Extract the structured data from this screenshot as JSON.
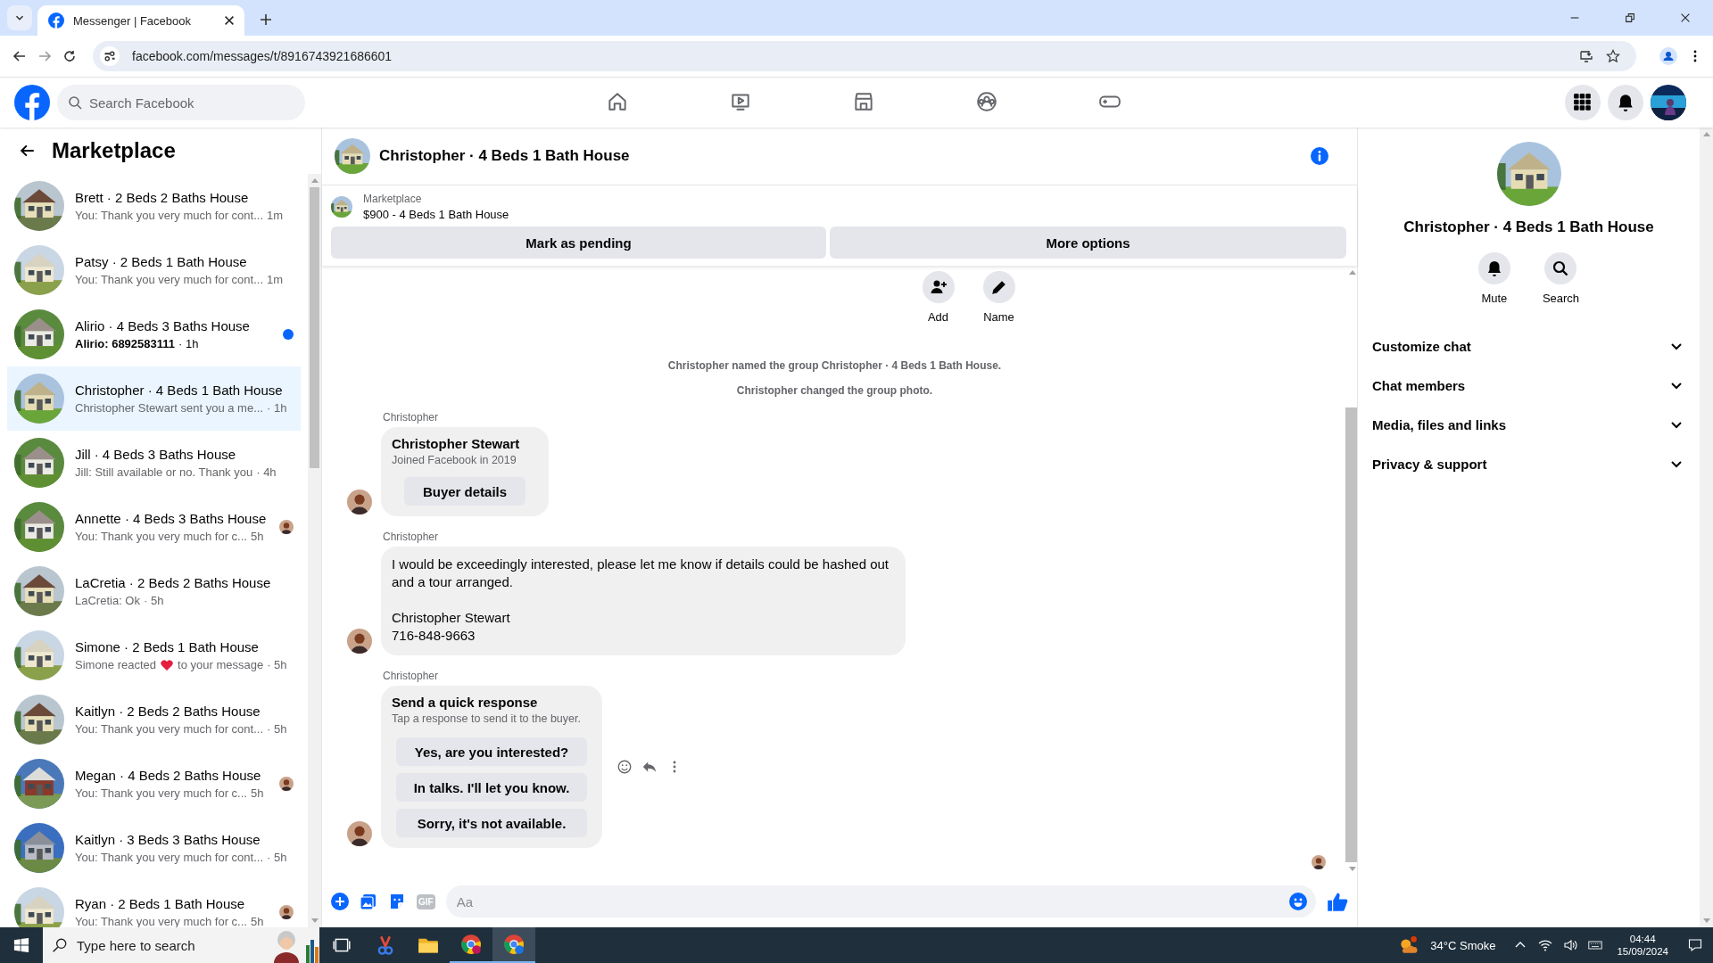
{
  "browser": {
    "tab": {
      "title": "Messenger | Facebook",
      "selected": true
    },
    "url": "facebook.com/messages/t/8916743921686601"
  },
  "topbar": {
    "search_placeholder": "Search Facebook",
    "nav": [
      {
        "selected": false
      },
      {
        "selected": false
      },
      {
        "selected": false
      },
      {
        "selected": false
      },
      {
        "selected": false
      }
    ]
  },
  "sidebar": {
    "title": "Marketplace",
    "conversations": [
      {
        "name": "Brett · 2 Beds 2 Baths House",
        "preview": "You: Thank you very much for cont...",
        "time": "1m",
        "unread": false,
        "seen_avatar": false,
        "selected": false
      },
      {
        "name": "Patsy · 2 Beds 1 Bath House",
        "preview": "You: Thank you very much for cont...",
        "time": "1m",
        "unread": false,
        "seen_avatar": false,
        "selected": false
      },
      {
        "name": "Alirio · 4 Beds 3 Baths House",
        "preview": "Alirio: 6892583111",
        "time": "· 1h",
        "unread": true,
        "seen_avatar": false,
        "selected": false
      },
      {
        "name": "Christopher · 4 Beds 1 Bath House",
        "preview": "Christopher Stewart sent you a me...",
        "time": "· 1h",
        "unread": false,
        "seen_avatar": false,
        "selected": true
      },
      {
        "name": "Jill · 4 Beds 3 Baths House",
        "preview": "Jill: Still available or no. Thank you",
        "time": "· 4h",
        "unread": false,
        "seen_avatar": false,
        "selected": false
      },
      {
        "name": "Annette · 4 Beds 3 Baths House",
        "preview": "You: Thank you very much for c...",
        "time": "5h",
        "unread": false,
        "seen_avatar": true,
        "selected": false
      },
      {
        "name": "LaCretia · 2 Beds 2 Baths House",
        "preview": "LaCretia: Ok",
        "time": "· 5h",
        "unread": false,
        "seen_avatar": false,
        "selected": false
      },
      {
        "name": "Simone · 2 Beds 1 Bath House",
        "preview": "Simone reacted",
        "preview_end": "to your message",
        "time": "· 5h",
        "unread": false,
        "seen_avatar": false,
        "selected": false
      },
      {
        "name": "Kaitlyn · 2 Beds 2 Baths House",
        "preview": "You: Thank you very much for cont...",
        "time": "· 5h",
        "unread": false,
        "seen_avatar": false,
        "selected": false
      },
      {
        "name": "Megan · 4 Beds 2 Baths House",
        "preview": "You: Thank you very much for c...",
        "time": "5h",
        "unread": false,
        "seen_avatar": true,
        "selected": false
      },
      {
        "name": "Kaitlyn · 3 Beds 3 Baths House",
        "preview": "You: Thank you very much for cont...",
        "time": "· 5h",
        "unread": false,
        "seen_avatar": false,
        "selected": false
      },
      {
        "name": "Ryan · 2 Beds 1 Bath House",
        "preview": "You: Thank you very much for c...",
        "time": "5h",
        "unread": false,
        "seen_avatar": true,
        "selected": false
      }
    ]
  },
  "chat": {
    "title": "Christopher · 4 Beds 1 Bath House",
    "listing": {
      "label": "Marketplace",
      "title": "$900 - 4 Beds 1 Bath House",
      "buttons": [
        "Mark as pending",
        "More options"
      ]
    },
    "group_actions": [
      "Add",
      "Name"
    ],
    "messages": [
      {
        "kind": "system",
        "text": "Christopher named the group Christopher · 4 Beds 1 Bath House."
      },
      {
        "kind": "system",
        "text": "Christopher changed the group photo."
      },
      {
        "kind": "profile_card",
        "sender": "Christopher",
        "name": "Christopher Stewart",
        "subtitle": "Joined Facebook in 2019",
        "button": "Buyer details"
      },
      {
        "kind": "text",
        "sender": "Christopher",
        "paragraphs": [
          [
            "I would be exceedingly interested, please let me know if details could be hashed out and a tour arranged."
          ],
          [
            "Christopher Stewart",
            "716-848-9663"
          ]
        ]
      },
      {
        "kind": "quick_response",
        "sender": "Christopher",
        "title": "Send a quick response",
        "subtitle": "Tap a response to send it to the buyer.",
        "options": [
          "Yes, are you interested?",
          "In talks. I'll let you know.",
          "Sorry, it's not available."
        ],
        "show_actions": true
      }
    ],
    "seen_avatar": true,
    "composer": {
      "placeholder": "Aa",
      "gif_label": "GIF"
    }
  },
  "details": {
    "title": "Christopher · 4 Beds 1 Bath House",
    "actions": [
      "Mute",
      "Search"
    ],
    "sections": [
      {
        "label": "Customize chat",
        "expanded": false
      },
      {
        "label": "Chat members",
        "expanded": false
      },
      {
        "label": "Media, files and links",
        "expanded": false
      },
      {
        "label": "Privacy & support",
        "expanded": false
      }
    ]
  },
  "taskbar": {
    "search_placeholder": "Type here to search",
    "weather": "34°C Smoke",
    "time": "04:44",
    "date": "15/09/2024"
  }
}
